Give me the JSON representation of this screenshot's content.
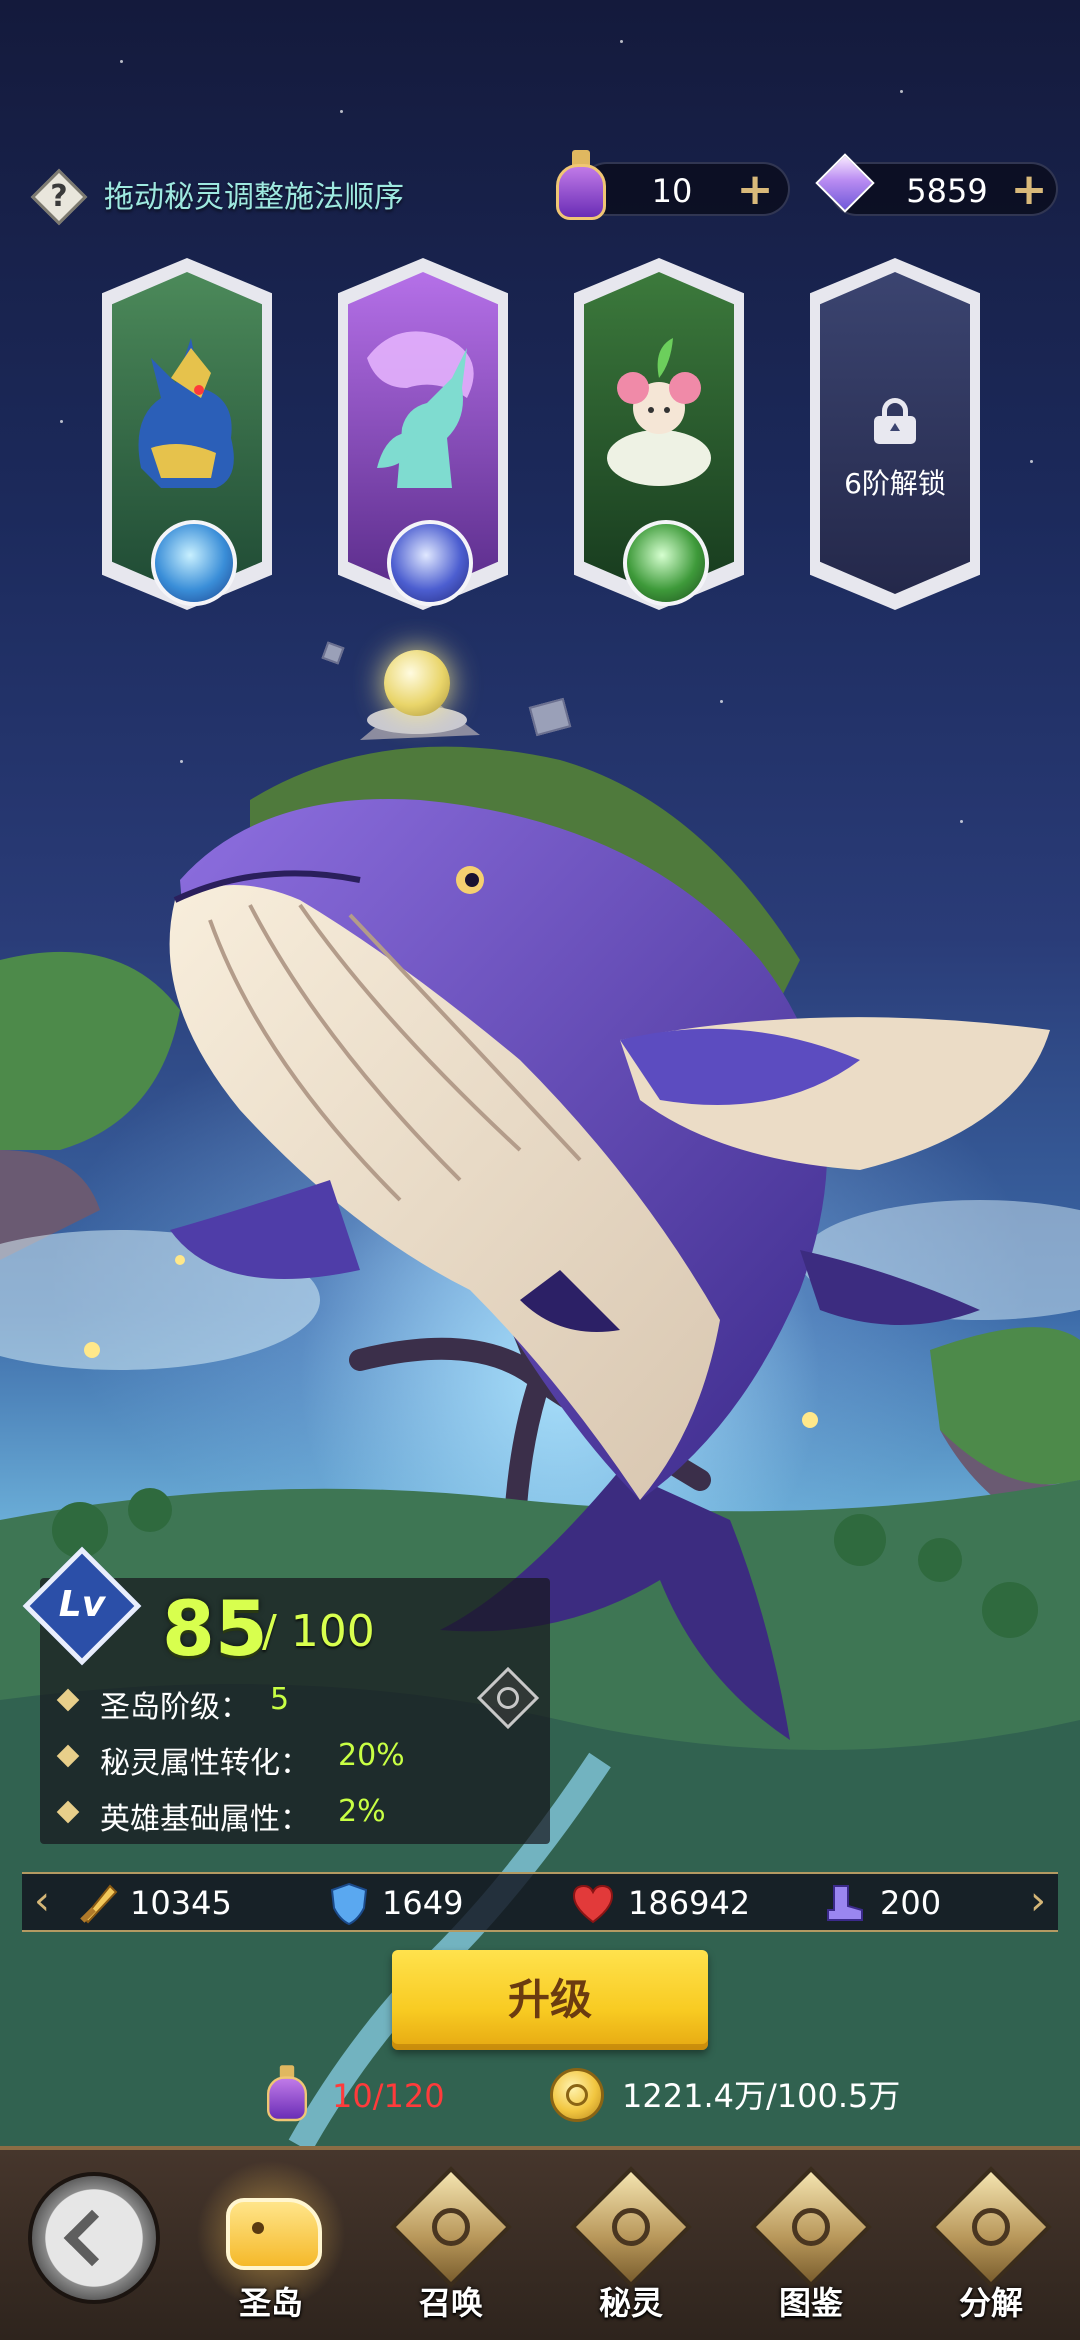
{
  "top_bar": {
    "hint": "拖动秘灵调整施法顺序",
    "potion_count": "10",
    "gem_count": "5859",
    "add_symbol": "+"
  },
  "spirits": [
    {
      "name": "blue-wolf-spirit",
      "element": "water",
      "locked": false
    },
    {
      "name": "unicorn-spirit",
      "element": "lightning",
      "locked": false
    },
    {
      "name": "flower-sprout-spirit",
      "element": "nature",
      "locked": false
    },
    {
      "name": "locked-slot",
      "locked": true,
      "unlock_text": "6阶解锁"
    }
  ],
  "level": {
    "badge": "Lv",
    "current": "85",
    "max": "/ 100",
    "stats": [
      {
        "label": "圣岛阶级：",
        "value": "5"
      },
      {
        "label": "秘灵属性转化：",
        "value": "20%"
      },
      {
        "label": "英雄基础属性：",
        "value": "2%"
      }
    ]
  },
  "stats_bar": {
    "attack": "10345",
    "defense": "1649",
    "health": "186942",
    "speed": "200"
  },
  "upgrade": {
    "label": "升级",
    "potion_cost": "10/120",
    "coin_cost": "1221.4万/100.5万"
  },
  "nav": {
    "items": [
      {
        "label": "圣岛",
        "active": true
      },
      {
        "label": "召唤",
        "active": false
      },
      {
        "label": "秘灵",
        "active": false
      },
      {
        "label": "图鉴",
        "active": false
      },
      {
        "label": "分解",
        "active": false
      }
    ]
  },
  "colors": {
    "accent_green": "#d8ff4e",
    "cost_red": "#ff3b3b",
    "upgrade_yellow": "#f8cb22",
    "hint_teal": "#9ee9e0"
  }
}
